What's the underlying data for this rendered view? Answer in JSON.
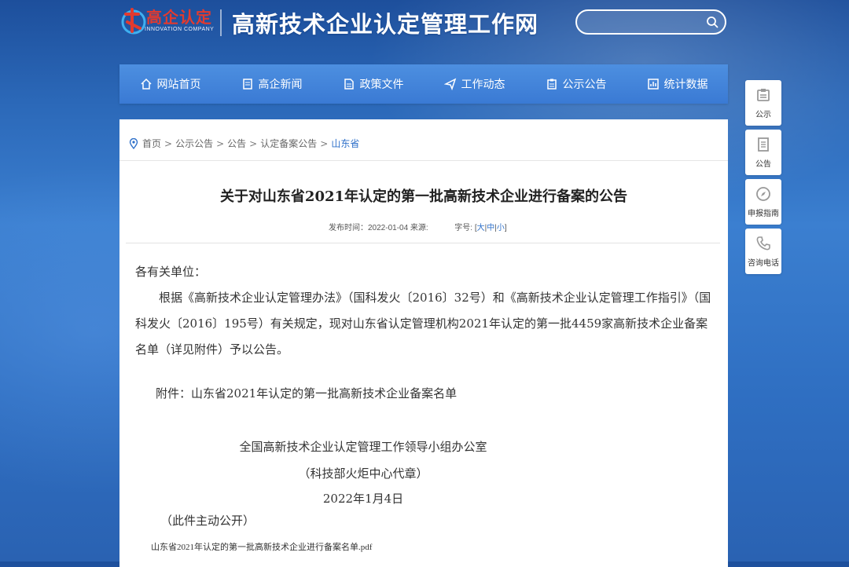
{
  "header": {
    "logo_text": "高企认定",
    "logo_sub": "INNOVATION COMPANY",
    "site_title": "高新技术企业认定管理工作网",
    "search_placeholder": "",
    "search_icon": "search-icon"
  },
  "nav": {
    "items": [
      {
        "label": "网站首页",
        "icon": "home-icon"
      },
      {
        "label": "高企新闻",
        "icon": "news-icon"
      },
      {
        "label": "政策文件",
        "icon": "document-icon"
      },
      {
        "label": "工作动态",
        "icon": "send-icon"
      },
      {
        "label": "公示公告",
        "icon": "clipboard-icon"
      },
      {
        "label": "统计数据",
        "icon": "chart-icon"
      }
    ]
  },
  "breadcrumb": {
    "items": [
      "首页",
      "公示公告",
      "公告",
      "认定备案公告"
    ],
    "current": "山东省",
    "sep": ">"
  },
  "article": {
    "title": "关于对山东省2021年认定的第一批高新技术企业进行备案的公告",
    "meta_publish": "发布时间：2022-01-04 来源:",
    "meta_fontsize_label": "字号:",
    "font_sizes": [
      "大",
      "中",
      "小"
    ],
    "salutation": "各有关单位：",
    "paragraph": "根据《高新技术企业认定管理办法》（国科发火〔2016〕32号）和《高新技术企业认定管理工作指引》（国科发火〔2016〕195号）有关规定，现对山东省认定管理机构2021年认定的第一批4459家高新技术企业备案名单（详见附件）予以公告。",
    "attachment": "附件：山东省2021年认定的第一批高新技术企业备案名单",
    "signer": "全国高新技术企业认定管理工作领导小组办公室",
    "signer_note": "（科技部火炬中心代章）",
    "date": "2022年1月4日",
    "public_note": "（此件主动公开）",
    "pdf_link": "山东省2021年认定的第一批高新技术企业进行备案名单.pdf"
  },
  "float_menu": {
    "items": [
      {
        "label": "公示",
        "icon": "notice-icon"
      },
      {
        "label": "公告",
        "icon": "announcement-icon"
      },
      {
        "label": "申报指南",
        "icon": "compass-icon"
      },
      {
        "label": "咨询电话",
        "icon": "phone-icon"
      }
    ]
  },
  "colors": {
    "accent": "#2d6fc9",
    "nav_bg": "#4086da",
    "logo_red": "#e23a2f"
  }
}
